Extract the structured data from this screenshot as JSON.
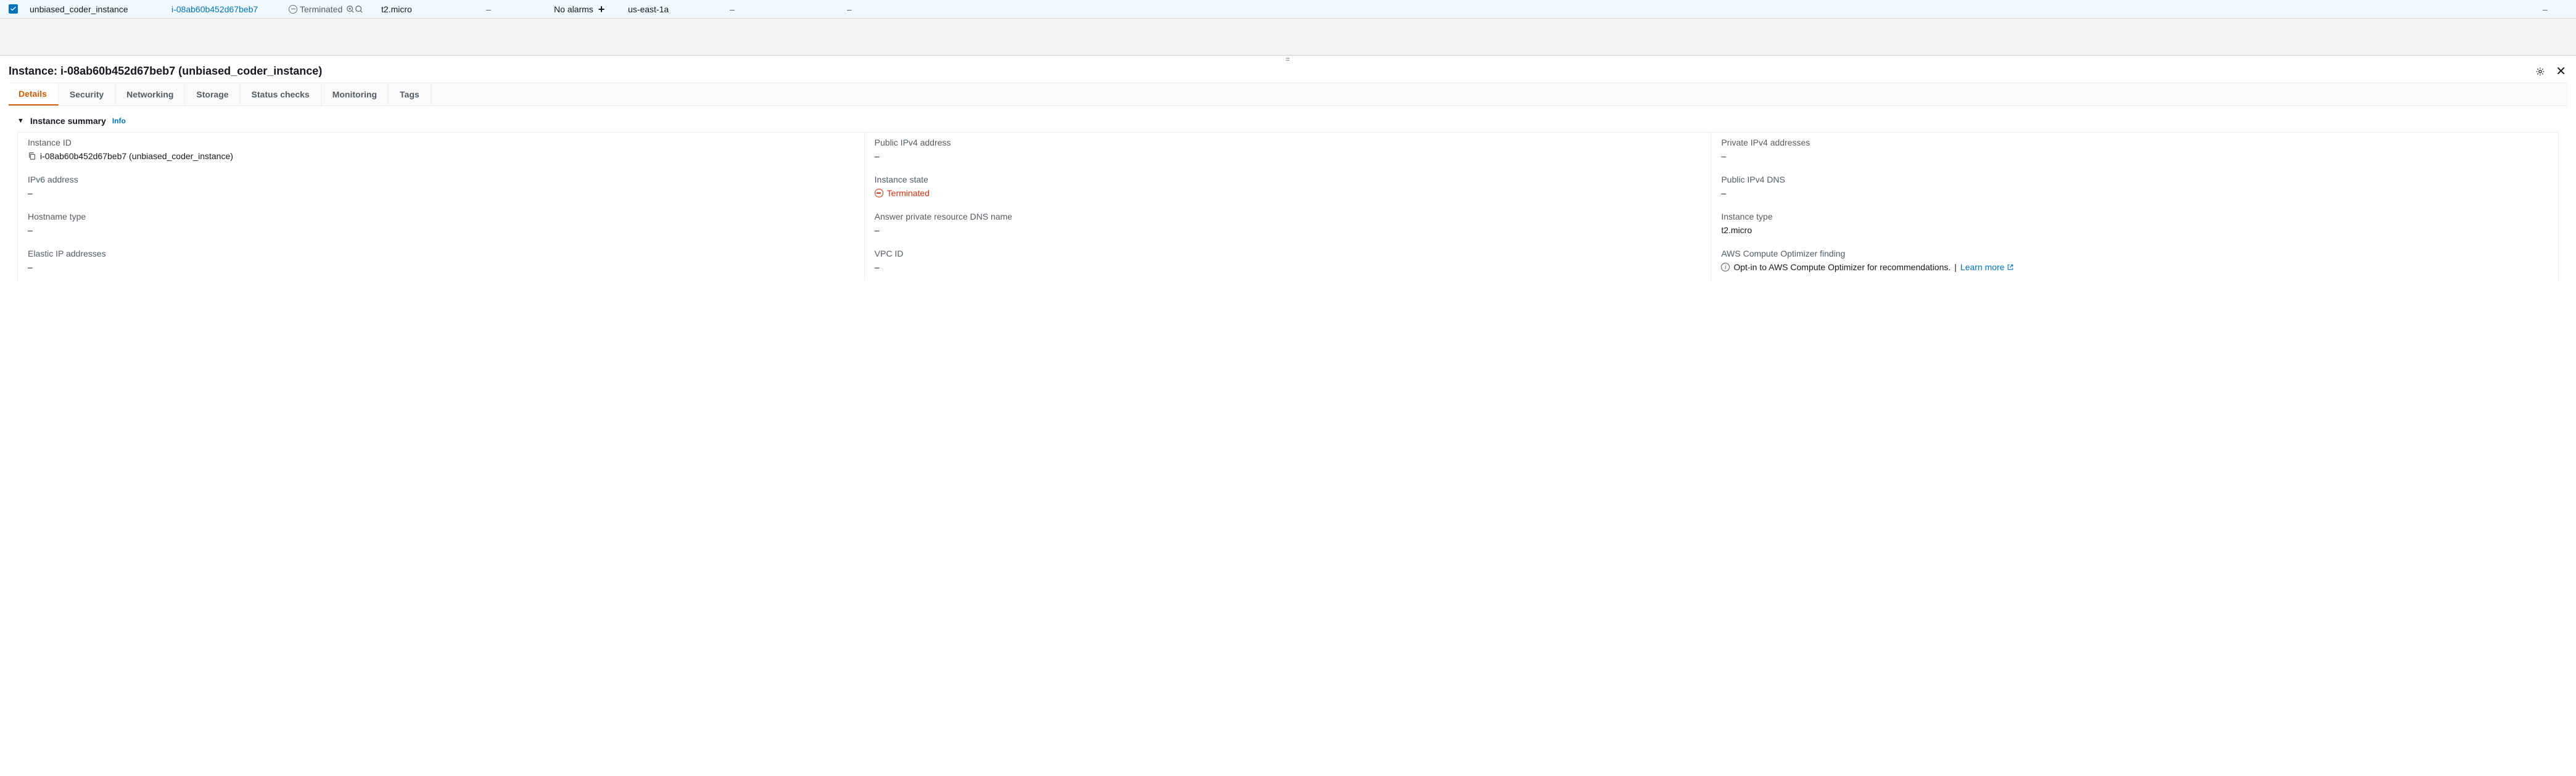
{
  "row": {
    "name": "unbiased_coder_instance",
    "id": "i-08ab60b452d67beb7",
    "state": "Terminated",
    "type": "t2.micro",
    "status_check": "–",
    "alarm": "No alarms",
    "az": "us-east-1a",
    "public_ip": "–",
    "private_ip": "–",
    "monitoring": "–"
  },
  "panel": {
    "title_prefix": "Instance:",
    "title_id": "i-08ab60b452d67beb7",
    "title_name": "(unbiased_coder_instance)"
  },
  "tabs": [
    "Details",
    "Security",
    "Networking",
    "Storage",
    "Status checks",
    "Monitoring",
    "Tags"
  ],
  "section": {
    "title": "Instance summary",
    "info": "Info"
  },
  "fields": {
    "instance_id_label": "Instance ID",
    "instance_id_value": "i-08ab60b452d67beb7 (unbiased_coder_instance)",
    "public_ipv4_label": "Public IPv4 address",
    "public_ipv4_value": "–",
    "private_ipv4_label": "Private IPv4 addresses",
    "private_ipv4_value": "–",
    "ipv6_label": "IPv6 address",
    "ipv6_value": "–",
    "instance_state_label": "Instance state",
    "instance_state_value": "Terminated",
    "public_dns_label": "Public IPv4 DNS",
    "public_dns_value": "–",
    "hostname_label": "Hostname type",
    "hostname_value": "–",
    "answer_dns_label": "Answer private resource DNS name",
    "answer_dns_value": "–",
    "instance_type_label": "Instance type",
    "instance_type_value": "t2.micro",
    "eip_label": "Elastic IP addresses",
    "eip_value": "–",
    "vpc_label": "VPC ID",
    "vpc_value": "–",
    "optimizer_label": "AWS Compute Optimizer finding",
    "optimizer_text": "Opt-in to AWS Compute Optimizer for recommendations.",
    "optimizer_sep": " | ",
    "optimizer_learn": "Learn more"
  }
}
